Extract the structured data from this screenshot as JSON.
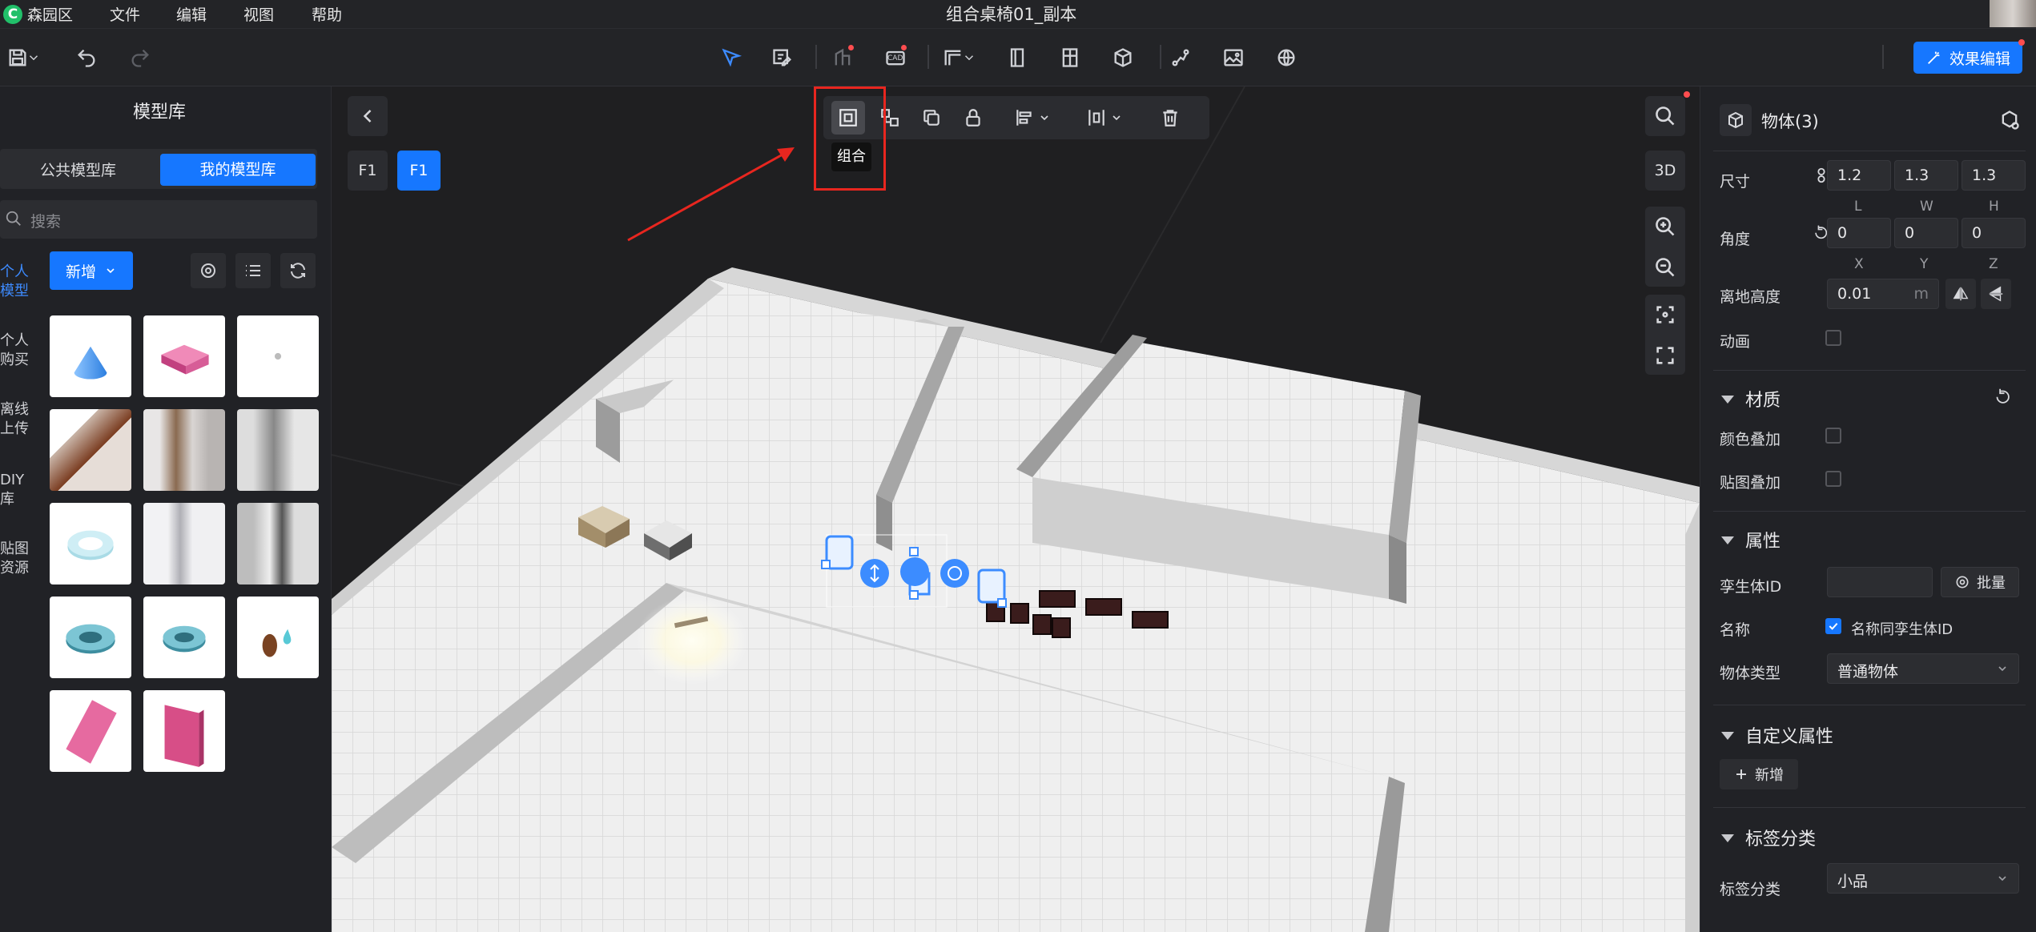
{
  "app": {
    "logo": "C",
    "name": "森园区",
    "menus": [
      "文件",
      "编辑",
      "视图",
      "帮助"
    ],
    "title": "组合桌椅01_副本"
  },
  "toolbar": {
    "effect_edit": "效果编辑",
    "cad_badge": "CAD"
  },
  "left_panel": {
    "title": "模型库",
    "tabs": [
      "公共模型库",
      "我的模型库"
    ],
    "search_placeholder": "搜索",
    "categories": [
      "个人模型",
      "个人购买",
      "离线上传",
      "DIY库",
      "贴图资源"
    ],
    "add_button": "新增"
  },
  "viewport": {
    "floor_tabs": [
      "F1",
      "F1"
    ],
    "view_mode": "3D",
    "tooltip": "组合",
    "selection_toolbar": [
      "group-icon",
      "ungroup-icon",
      "copy-icon",
      "lock-icon",
      "align-icon",
      "distribute-icon",
      "delete-icon"
    ]
  },
  "right_panel": {
    "header": "物体(3)",
    "size_label": "尺寸",
    "size": [
      "1.2",
      "1.3",
      "1.3"
    ],
    "size_axes": [
      "L",
      "W",
      "H"
    ],
    "angle_label": "角度",
    "angle": [
      "0",
      "0",
      "0"
    ],
    "angle_axes": [
      "X",
      "Y",
      "Z"
    ],
    "height_label": "离地高度",
    "height_value": "0.01",
    "height_unit": "m",
    "animation_label": "动画",
    "material": {
      "title": "材质",
      "color_overlay": "颜色叠加",
      "texture_overlay": "贴图叠加"
    },
    "attributes": {
      "title": "属性",
      "twin_id": "孪生体ID",
      "batch": "批量",
      "name": "名称",
      "name_same": "名称同孪生体ID",
      "type_label": "物体类型",
      "type_value": "普通物体"
    },
    "custom": {
      "title": "自定义属性",
      "add": "新增"
    },
    "tags": {
      "title": "标签分类",
      "label": "标签分类",
      "value": "小品"
    }
  },
  "colors": {
    "accent": "#1677ff",
    "highlight_box": "#e8261f",
    "arrow": "#e8261f",
    "selection": "#3c8cff"
  }
}
